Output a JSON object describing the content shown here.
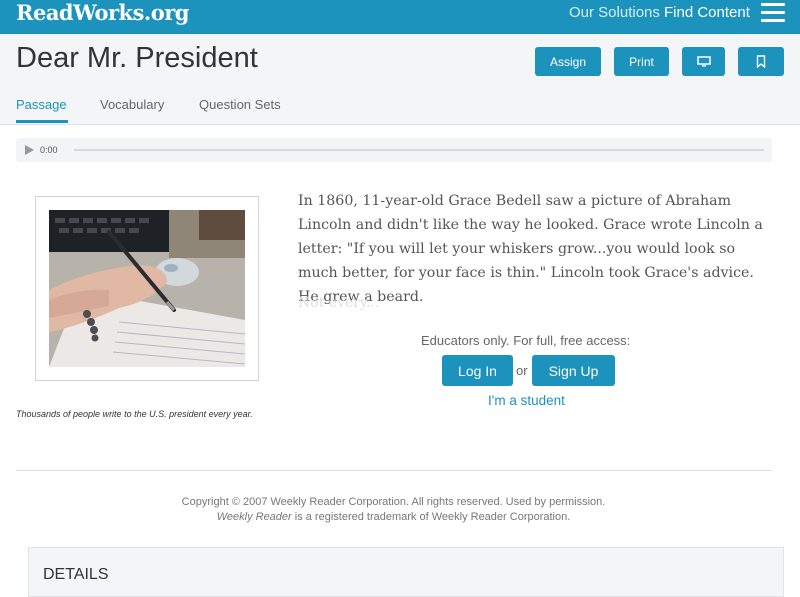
{
  "header": {
    "logo": "ReadWorks.org",
    "nav": [
      "Our Solutions",
      "Find Content"
    ]
  },
  "page": {
    "title": "Dear Mr. President",
    "buttons": {
      "assign": "Assign",
      "print": "Print"
    },
    "icons": {
      "present": "monitor-icon",
      "bookmark": "bookmark-icon",
      "menu": "hamburger-menu-icon",
      "play": "play-icon"
    }
  },
  "tabs": [
    "Passage",
    "Vocabulary",
    "Question Sets"
  ],
  "audio": {
    "time": "0:00"
  },
  "figure": {
    "caption": "Thousands of people write to the U.S. president every year."
  },
  "passage": {
    "text": "In 1860, 11-year-old Grace Bedell saw a picture of Abraham Lincoln and didn't like the way he looked. Grace wrote Lincoln a letter: \"If you will let your whiskers grow...you would look so much better, for your face is thin.\" Lincoln took Grace's advice. He grew a beard.",
    "fade_text": "Not every..."
  },
  "access": {
    "note": "Educators only. For full, free access:",
    "login": "Log In",
    "or": "or",
    "signup": "Sign Up",
    "student": "I'm a student"
  },
  "footer": {
    "line1": "Copyright © 2007 Weekly Reader Corporation. All rights reserved. Used by permission.",
    "line2_italic": "Weekly Reader",
    "line2_rest": " is a registered trademark of Weekly Reader Corporation."
  },
  "details": {
    "title": "DETAILS"
  },
  "colors": {
    "brand": "#1b93bd"
  }
}
